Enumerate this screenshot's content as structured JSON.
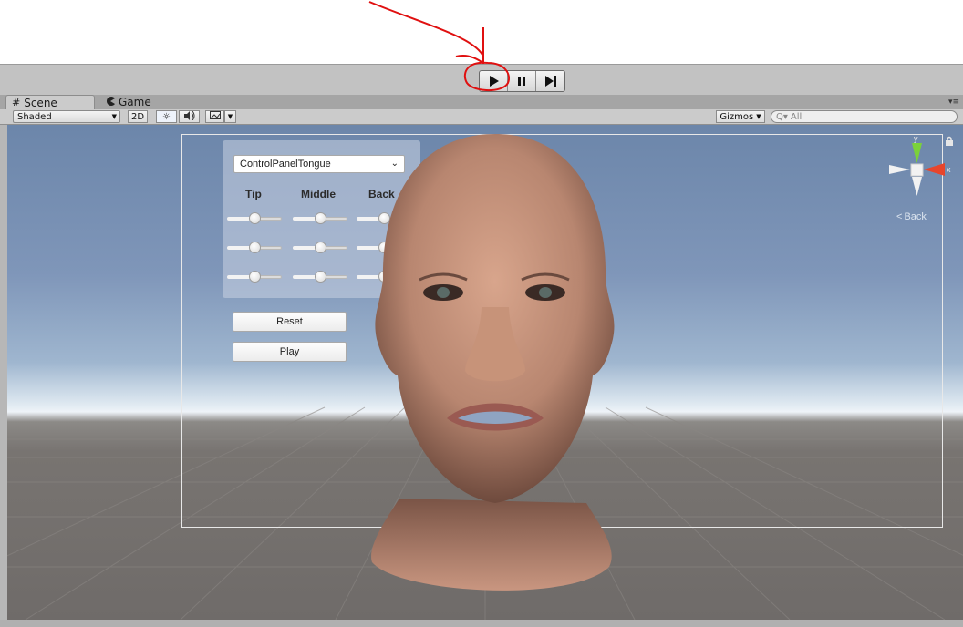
{
  "playbar": {
    "play_label": "play",
    "pause_label": "pause",
    "step_label": "step"
  },
  "tabs": [
    {
      "label": "Scene",
      "icon": "grid-icon",
      "active": true
    },
    {
      "label": "Game",
      "icon": "pacman-icon",
      "active": false
    }
  ],
  "scene_toolbar": {
    "shading_mode": "Shaded",
    "mode_2d": "2D",
    "gizmos_label": "Gizmos",
    "search_placeholder": "All"
  },
  "scene_ui": {
    "dropdown_value": "ControlPanelTongue",
    "columns": [
      "Tip",
      "Middle",
      "Back"
    ],
    "slider_values": [
      [
        0.5,
        0.5,
        0.5
      ],
      [
        0.5,
        0.5,
        0.5
      ],
      [
        0.5,
        0.5,
        0.5
      ]
    ],
    "reset_label": "Reset",
    "play_label": "Play"
  },
  "orientation_gizmo": {
    "y_label": "y",
    "x_label": "x",
    "back_label": "Back"
  },
  "colors": {
    "annotation_red": "#e01010",
    "gizmo_y": "#7bd13a",
    "gizmo_x": "#e8452c"
  }
}
